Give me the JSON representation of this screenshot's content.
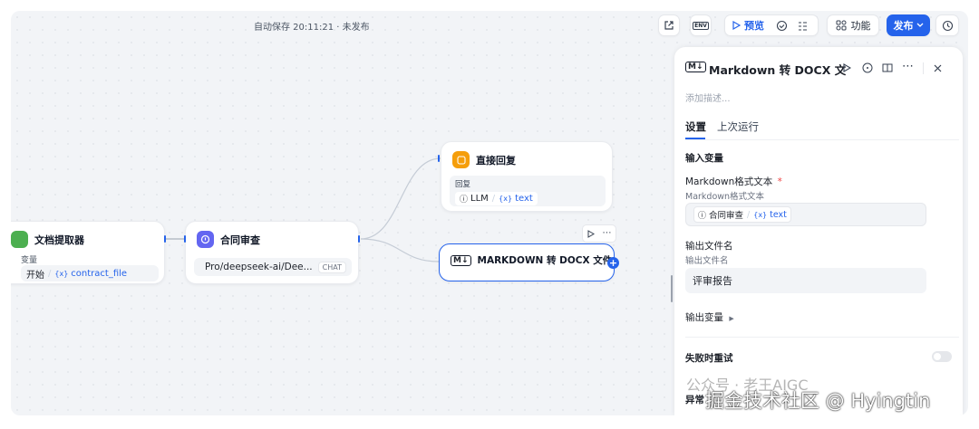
{
  "toolbar": {
    "autosave": "自动保存 20:11:21 · 未发布",
    "preview_label": "预览",
    "features_label": "功能",
    "publish_label": "发布",
    "env_label": "ENV"
  },
  "nodes": {
    "doc_extractor": {
      "title": "文档提取器",
      "input_label": "变量",
      "source": "开始",
      "var_prefix": "{x}",
      "var_name": "contract_file",
      "icon_color": "#4caf50"
    },
    "contract_review": {
      "title": "合同审查",
      "model": "Pro/deepseek-ai/Dee...",
      "model_tag": "CHAT",
      "icon_color": "#6366f1"
    },
    "direct_reply": {
      "title": "直接回复",
      "reply_label": "回复",
      "source": "LLM",
      "var_prefix": "{x}",
      "var_name": "text",
      "icon_color": "#f59e0b"
    },
    "markdown_docx": {
      "title": "MARKDOWN 转 DOCX 文件",
      "icon": "M↓"
    }
  },
  "panel": {
    "title": "Markdown 转 DOCX 文",
    "icon": "M↓",
    "description_placeholder": "添加描述...",
    "tabs": [
      "设置",
      "上次运行"
    ],
    "input_vars_heading": "输入变量",
    "md_text_label": "Markdown格式文本",
    "md_text_required": "*",
    "md_text_sub": "Markdown格式文本",
    "md_text_source": "合同审查",
    "md_text_var_prefix": "{x}",
    "md_text_var": "text",
    "output_filename_label": "输出文件名",
    "output_filename_sub": "输出文件名",
    "output_filename_value": "评审报告",
    "output_vars_label": "输出变量",
    "retry_label": "失败时重试",
    "exception_label": "异常"
  },
  "watermark": {
    "line1": "公众号 · 老王AIGC",
    "line2": "掘金技术社区 @ Hyingtin"
  }
}
